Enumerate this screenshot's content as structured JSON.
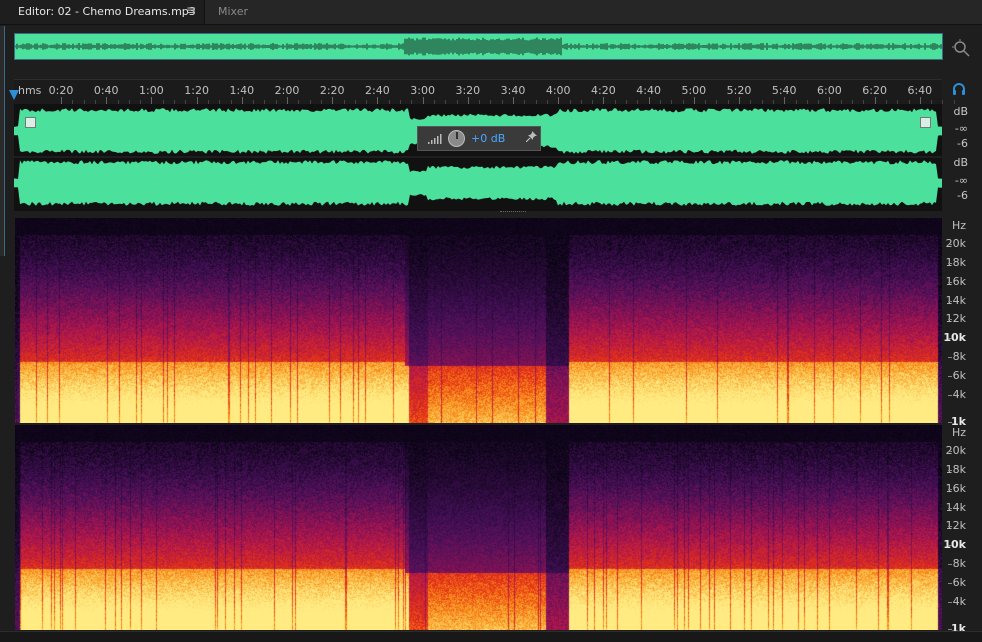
{
  "tabs": {
    "editor_label": "Editor: 02 - Chemo Dreams.mp3",
    "menu_glyph": "≡",
    "mixer_label": "Mixer"
  },
  "ruler": {
    "unit_label": "hms",
    "labels": [
      "0:20",
      "0:40",
      "1:00",
      "1:20",
      "1:40",
      "2:00",
      "2:20",
      "2:40",
      "3:00",
      "3:20",
      "3:40",
      "4:00",
      "4:20",
      "4:40",
      "5:00",
      "5:20",
      "5:40",
      "6:00",
      "6:20",
      "6:40"
    ]
  },
  "waveform": {
    "color": "#4be09b",
    "channels": [
      {
        "db_label": "dB",
        "inf_label": "-∞",
        "neg6_label": "-6"
      },
      {
        "db_label": "dB",
        "inf_label": "-∞",
        "neg6_label": "-6"
      }
    ]
  },
  "hud": {
    "volume_value": "+0 dB"
  },
  "spectral": {
    "channels": [
      {
        "unit": "Hz",
        "labels": [
          "20k",
          "18k",
          "16k",
          "14k",
          "12k",
          "10k",
          "8k",
          "6k",
          "4k",
          "1k"
        ]
      },
      {
        "unit": "Hz",
        "labels": [
          "20k",
          "18k",
          "16k",
          "14k",
          "12k",
          "10k",
          "8k",
          "6k",
          "4k",
          "1k"
        ]
      }
    ]
  },
  "icons": {
    "zoom": "zoom-navigator-icon",
    "headphones": "headphones-icon",
    "pin": "pin-icon",
    "level_meter": "level-meter-icon"
  },
  "colors": {
    "accent": "#2d8fd6",
    "hud_value": "#4aa8ff"
  }
}
